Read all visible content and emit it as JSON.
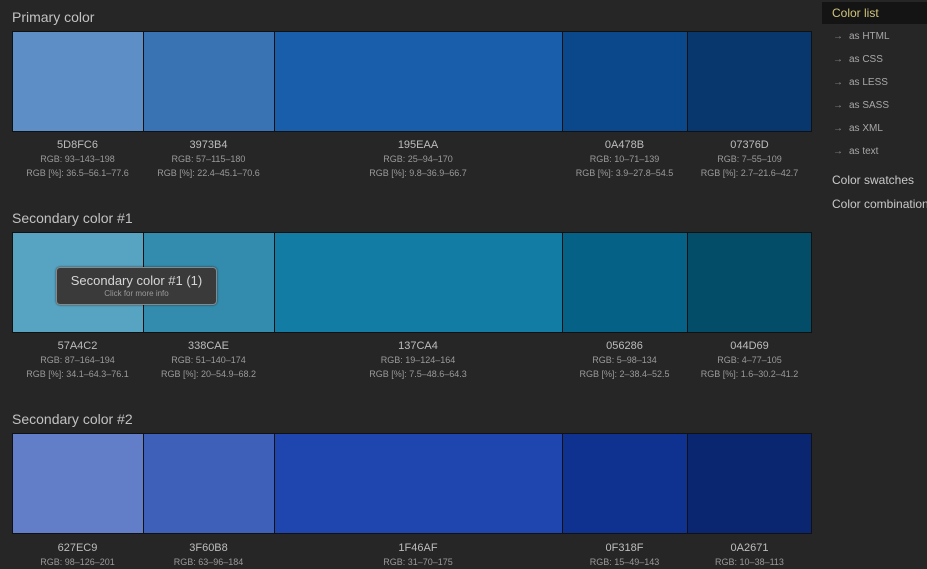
{
  "sections": [
    {
      "title": "Primary color",
      "swatches": [
        {
          "hex": "5D8FC6",
          "color": "#5D8FC6",
          "rgb": "RGB: 93–143–198",
          "pct": "RGB [%]: 36.5–56.1–77.6"
        },
        {
          "hex": "3973B4",
          "color": "#3973B4",
          "rgb": "RGB: 57–115–180",
          "pct": "RGB [%]: 22.4–45.1–70.6"
        },
        {
          "hex": "195EAA",
          "color": "#195EAA",
          "rgb": "RGB: 25–94–170",
          "pct": "RGB [%]: 9.8–36.9–66.7"
        },
        {
          "hex": "0A478B",
          "color": "#0A478B",
          "rgb": "RGB: 10–71–139",
          "pct": "RGB [%]: 3.9–27.8–54.5"
        },
        {
          "hex": "07376D",
          "color": "#07376D",
          "rgb": "RGB: 7–55–109",
          "pct": "RGB [%]: 2.7–21.6–42.7"
        }
      ]
    },
    {
      "title": "Secondary color #1",
      "swatches": [
        {
          "hex": "57A4C2",
          "color": "#57A4C2",
          "rgb": "RGB: 87–164–194",
          "pct": "RGB [%]: 34.1–64.3–76.1"
        },
        {
          "hex": "338CAE",
          "color": "#338CAE",
          "rgb": "RGB: 51–140–174",
          "pct": "RGB [%]: 20–54.9–68.2"
        },
        {
          "hex": "137CA4",
          "color": "#137CA4",
          "rgb": "RGB: 19–124–164",
          "pct": "RGB [%]: 7.5–48.6–64.3"
        },
        {
          "hex": "056286",
          "color": "#056286",
          "rgb": "RGB: 5–98–134",
          "pct": "RGB [%]: 2–38.4–52.5"
        },
        {
          "hex": "044D69",
          "color": "#044D69",
          "rgb": "RGB: 4–77–105",
          "pct": "RGB [%]: 1.6–30.2–41.2"
        }
      ]
    },
    {
      "title": "Secondary color #2",
      "swatches": [
        {
          "hex": "627EC9",
          "color": "#627EC9",
          "rgb": "RGB: 98–126–201",
          "pct": ""
        },
        {
          "hex": "3F60B8",
          "color": "#3F60B8",
          "rgb": "RGB: 63–96–184",
          "pct": ""
        },
        {
          "hex": "1F46AF",
          "color": "#1F46AF",
          "rgb": "RGB: 31–70–175",
          "pct": ""
        },
        {
          "hex": "0F318F",
          "color": "#0F318F",
          "rgb": "RGB: 15–49–143",
          "pct": ""
        },
        {
          "hex": "0A2671",
          "color": "#0A2671",
          "rgb": "RGB: 10–38–113",
          "pct": ""
        }
      ]
    }
  ],
  "tooltip": {
    "title": "Secondary color #1 (1)",
    "subtitle": "Click for more info"
  },
  "sidebar": {
    "active": "Color list",
    "sub_items": [
      "as HTML",
      "as CSS",
      "as LESS",
      "as SASS",
      "as XML",
      "as text"
    ],
    "arrow": "→",
    "items": [
      "Color swatches",
      "Color combinations"
    ]
  }
}
